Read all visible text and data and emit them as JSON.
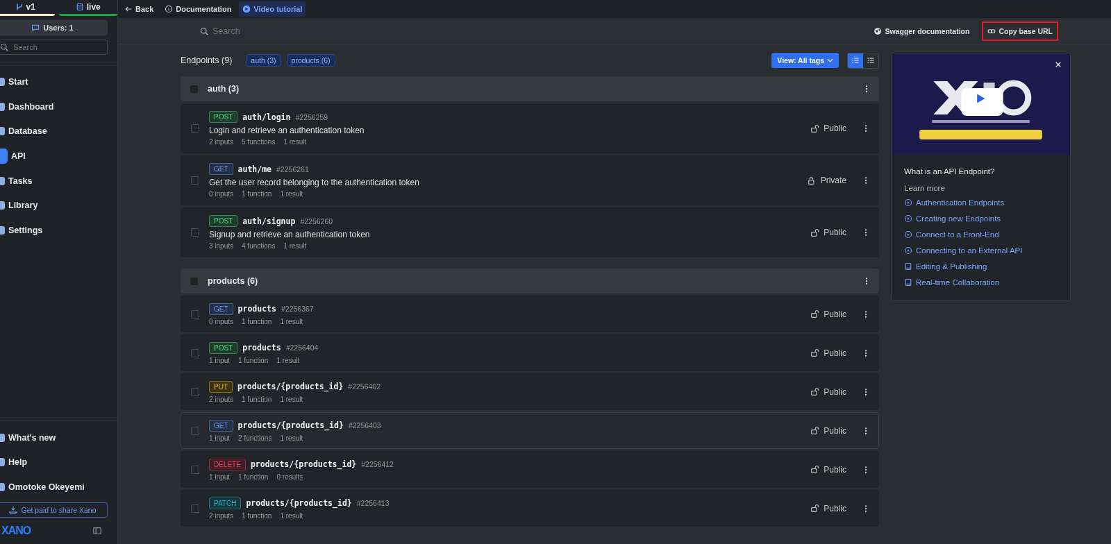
{
  "sidebar": {
    "branches": [
      {
        "label": "v1",
        "color": "#f5ecd0"
      },
      {
        "label": "live",
        "color": "#16a34a"
      }
    ],
    "users_button": "Users: 1",
    "search": {
      "placeholder": "Search"
    },
    "nav": [
      {
        "label": "Start",
        "selected": false
      },
      {
        "label": "Dashboard",
        "selected": false
      },
      {
        "label": "Database",
        "selected": false
      },
      {
        "label": "API",
        "selected": true
      },
      {
        "label": "Tasks",
        "selected": false
      },
      {
        "label": "Library",
        "selected": false
      },
      {
        "label": "Settings",
        "selected": false
      }
    ],
    "bottom": [
      {
        "label": "What's new"
      },
      {
        "label": "Help"
      },
      {
        "label": "Omotoke Okeyemi"
      }
    ],
    "promo_button": "Get paid to share Xano",
    "logo": "XANO"
  },
  "top_bar": {
    "tabs": [
      {
        "label": "Back",
        "selected": false
      },
      {
        "label": "Documentation",
        "selected": false
      },
      {
        "label": "Video tutorial",
        "selected": true
      }
    ]
  },
  "search_bar": {
    "placeholder": "Search",
    "actions": [
      {
        "label": "Swagger documentation",
        "highlighted": false
      },
      {
        "label": "Copy base URL",
        "highlighted": true
      }
    ]
  },
  "toolbar": {
    "title": "Endpoints (9)",
    "tags": [
      "auth (3)",
      "products (6)"
    ],
    "view_button": "View: All tags",
    "view_modes": [
      {
        "selected": true
      },
      {
        "selected": false
      }
    ]
  },
  "groups": [
    {
      "title": "auth (3)",
      "checked": false,
      "endpoints": [
        {
          "method": "POST",
          "color": "#4ade80",
          "path": "auth/login",
          "id": "#2256259",
          "description": "Login and retrieve an authentication token",
          "stats": [
            "2 inputs",
            "5 functions",
            "1 result"
          ],
          "locked": false,
          "access": "Public",
          "selected": false,
          "checked": false
        },
        {
          "method": "GET",
          "color": "#6b9cff",
          "path": "auth/me",
          "id": "#2256261",
          "description": "Get the user record belonging to the authentication token",
          "stats": [
            "0 inputs",
            "1 function",
            "1 result"
          ],
          "locked": true,
          "access": "Private",
          "selected": false,
          "checked": false
        },
        {
          "method": "POST",
          "color": "#4ade80",
          "path": "auth/signup",
          "id": "#2256260",
          "description": "Signup and retrieve an authentication token",
          "stats": [
            "3 inputs",
            "4 functions",
            "1 result"
          ],
          "locked": false,
          "access": "Public",
          "selected": false,
          "checked": false
        }
      ]
    },
    {
      "title": "products (6)",
      "checked": false,
      "endpoints": [
        {
          "method": "GET",
          "color": "#6b9cff",
          "path": "products",
          "id": "#2256367",
          "stats": [
            "0 inputs",
            "1 function",
            "1 result"
          ],
          "locked": false,
          "access": "Public",
          "selected": false,
          "checked": false
        },
        {
          "method": "POST",
          "color": "#4ade80",
          "path": "products",
          "id": "#2256404",
          "stats": [
            "1 input",
            "1 function",
            "1 result"
          ],
          "locked": false,
          "access": "Public",
          "selected": false,
          "checked": false
        },
        {
          "method": "PUT",
          "color": "#eab308",
          "path": "products/{products_id}",
          "id": "#2256402",
          "stats": [
            "2 inputs",
            "1 function",
            "1 result"
          ],
          "locked": false,
          "access": "Public",
          "selected": false,
          "checked": false
        },
        {
          "method": "GET",
          "color": "#6b9cff",
          "path": "products/{products_id}",
          "id": "#2256403",
          "stats": [
            "1 input",
            "2 functions",
            "1 result"
          ],
          "locked": false,
          "access": "Public",
          "selected": true,
          "checked": false
        },
        {
          "method": "DELETE",
          "color": "#f43f5e",
          "path": "products/{products_id}",
          "id": "#2256412",
          "stats": [
            "1 input",
            "1 function",
            "0 results"
          ],
          "locked": false,
          "access": "Public",
          "selected": false,
          "checked": false
        },
        {
          "method": "PATCH",
          "color": "#22b8cf",
          "path": "products/{products_id}",
          "id": "#2256413",
          "stats": [
            "2 inputs",
            "1 function",
            "1 result"
          ],
          "locked": false,
          "access": "Public",
          "selected": false,
          "checked": false
        }
      ]
    }
  ],
  "video_card": {
    "title": "What is an API Endpoint?",
    "subtitle": "Learn more",
    "links": [
      {
        "kind": "video",
        "label": "Authentication Endpoints"
      },
      {
        "kind": "video",
        "label": "Creating new Endpoints"
      },
      {
        "kind": "video",
        "label": "Connect to a Front-End"
      },
      {
        "kind": "video",
        "label": "Connecting to an External API"
      },
      {
        "kind": "doc",
        "label": "Editing & Publishing"
      },
      {
        "kind": "doc",
        "label": "Real-time Collaboration"
      }
    ]
  }
}
